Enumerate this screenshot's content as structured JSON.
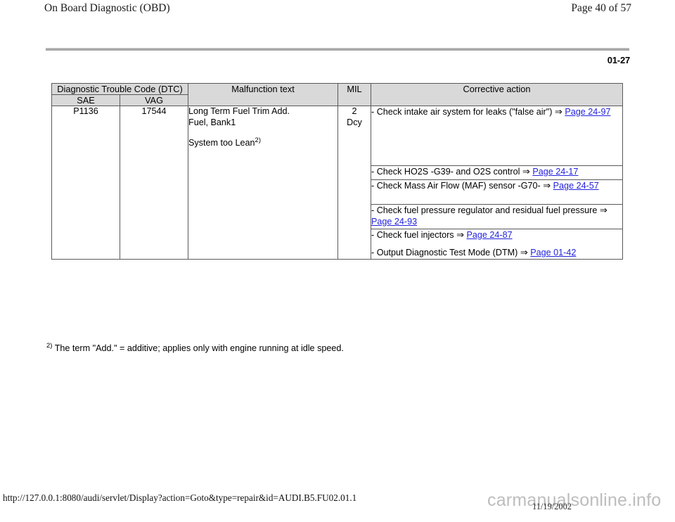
{
  "page_header": {
    "document_title": "On Board Diagnostic (OBD)",
    "page_indicator": "Page 40 of 57"
  },
  "section": {
    "code": "01-27"
  },
  "table": {
    "headers": {
      "dtc_group": "Diagnostic Trouble Code (DTC)",
      "dtc_sae": "SAE",
      "dtc_vag": "VAG",
      "malfunction_text": "Malfunction text",
      "mil": "MIL",
      "corrective_action": "Corrective action"
    },
    "row": {
      "sae": "P1136",
      "vag": "17544",
      "malfunction_line1": "Long Term Fuel Trim Add.",
      "malfunction_line2": "Fuel, Bank1",
      "malfunction_line3": "System too Lean",
      "malfunction_footnote_marker": "2)",
      "mil_value": "2",
      "mil_unit": "Dcy",
      "corrective_actions": [
        {
          "text_before": "- Check intake air system for leaks (\"false air\")",
          "arrow": "⇒",
          "link": "Page 24-97",
          "text_after": ""
        },
        {
          "text_before": "- Check HO2S -G39- and O2S control",
          "arrow": "⇒",
          "link": "Page 24-17",
          "text_after": ""
        },
        {
          "text_before": "- Check Mass Air Flow (MAF) sensor -G70-",
          "arrow": "⇒",
          "link": "Page 24-57",
          "text_after": ""
        },
        {
          "text_before": "- Check fuel pressure regulator and residual fuel pressure",
          "arrow": "⇒",
          "link": "Page 24-93",
          "text_after": ""
        },
        {
          "text_before": "- Check fuel injectors",
          "arrow": "⇒",
          "link": "Page 24-87",
          "text_after": ""
        },
        {
          "text_before": "- Output Diagnostic Test Mode (DTM)",
          "arrow": "⇒",
          "link": "Page 01-42",
          "text_after": ""
        }
      ]
    }
  },
  "footnote": {
    "marker": "2)",
    "text": "The term \"Add.\" = additive; applies only with engine running at idle speed."
  },
  "footer": {
    "url": "http://127.0.0.1:8080/audi/servlet/Display?action=Goto&type=repair&id=AUDI.B5.FU02.01.1",
    "watermark": "carmanualsonline.info",
    "date": "11/19/2002"
  },
  "colors": {
    "link": "#2222dd",
    "header_fill": "#d9d9d9",
    "rule": "#a8a8a8",
    "border": "#595959"
  }
}
